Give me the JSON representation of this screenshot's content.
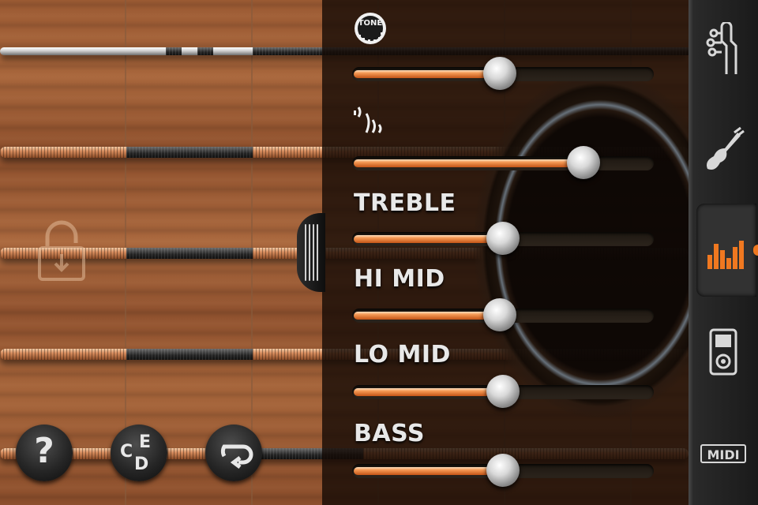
{
  "tone_panel": {
    "sliders": [
      {
        "id": "tone",
        "label": "",
        "icon": "tone-knob-icon",
        "icon_text": "TONE",
        "value": 0.49
      },
      {
        "id": "vibrato",
        "label": "",
        "icon": "vibrato-icon",
        "value": 0.77
      },
      {
        "id": "treble",
        "label": "TREBLE",
        "value": 0.5
      },
      {
        "id": "hi_mid",
        "label": "HI MID",
        "value": 0.49
      },
      {
        "id": "lo_mid",
        "label": "LO MID",
        "value": 0.5
      },
      {
        "id": "bass",
        "label": "BASS",
        "value": 0.5
      }
    ]
  },
  "sidebar": {
    "items": [
      {
        "id": "headstock",
        "icon": "guitar-headstock-icon",
        "active": false
      },
      {
        "id": "guitar",
        "icon": "electric-guitar-icon",
        "active": false
      },
      {
        "id": "equalizer",
        "icon": "equalizer-icon",
        "active": true
      },
      {
        "id": "player",
        "icon": "music-player-icon",
        "active": false
      },
      {
        "id": "midi",
        "icon": "midi-icon",
        "label": "MIDI",
        "active": false
      }
    ]
  },
  "bottom_buttons": [
    {
      "id": "help",
      "icon": "help-icon",
      "label": "?"
    },
    {
      "id": "notes",
      "icon": "chord-notes-icon",
      "letters": [
        "C",
        "E",
        "D"
      ]
    },
    {
      "id": "loop",
      "icon": "loop-icon"
    }
  ],
  "colors": {
    "accent": "#f07820",
    "slider_fill": "#f59a55",
    "panel": "#140a05"
  }
}
